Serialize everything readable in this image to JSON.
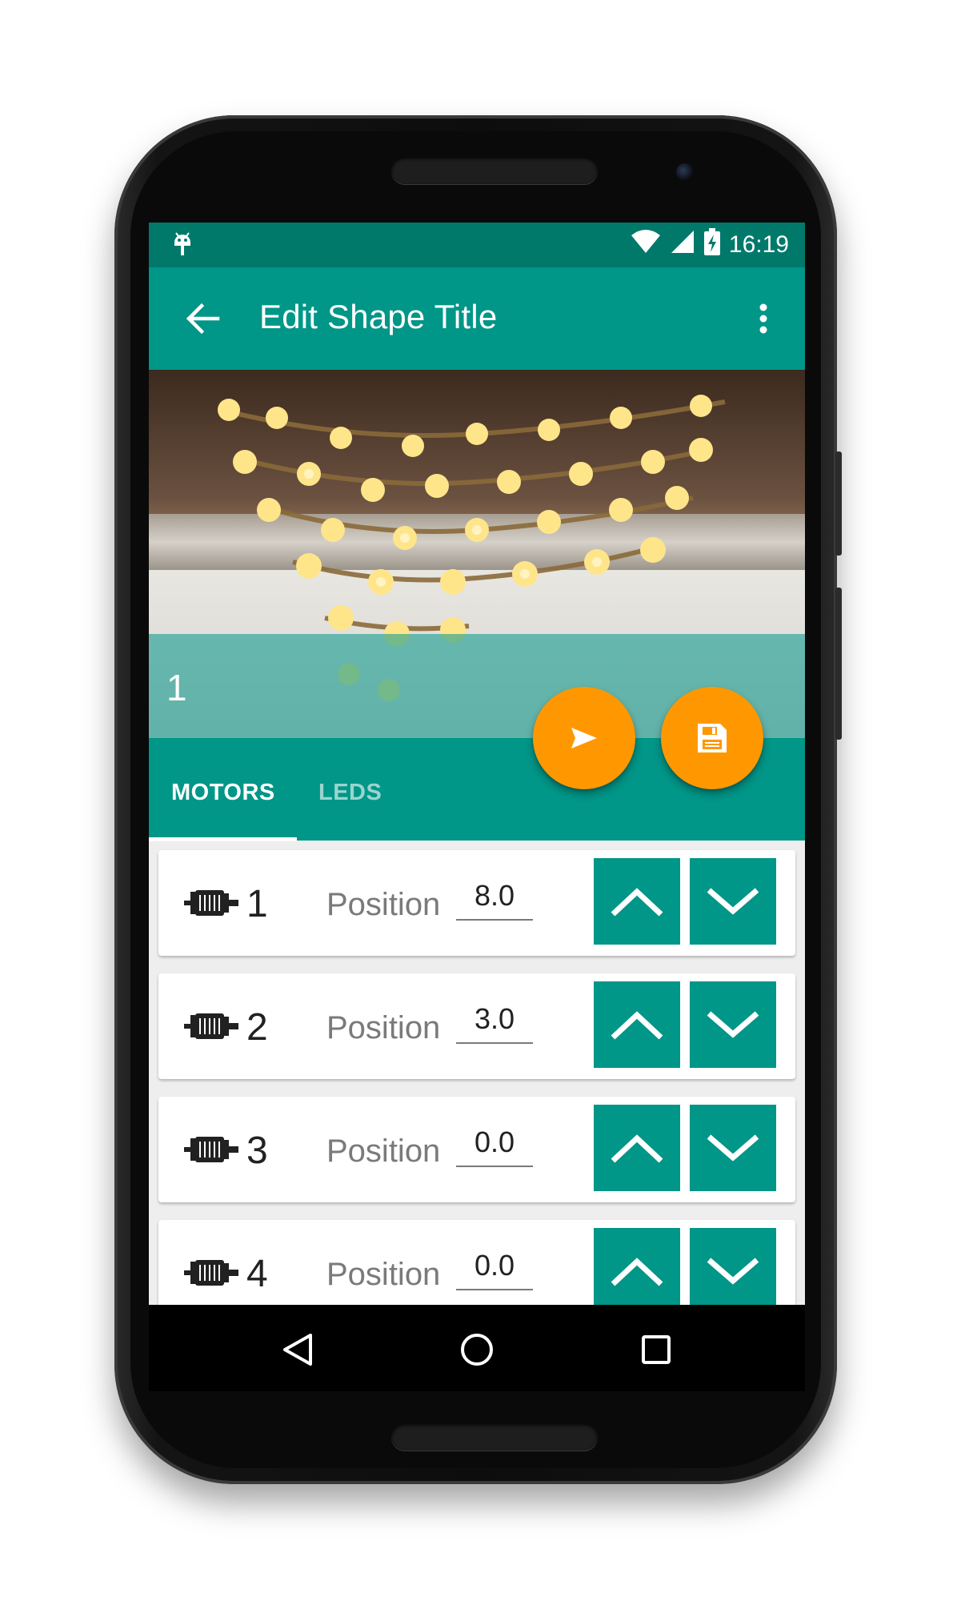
{
  "status_bar": {
    "time": "16:19",
    "icons": [
      "android-debug-icon",
      "wifi-icon",
      "signal-icon",
      "battery-charging-icon"
    ]
  },
  "toolbar": {
    "title": "Edit Shape Title",
    "back_icon": "arrow-back-icon",
    "menu_icon": "more-vert-icon"
  },
  "hero": {
    "label": "1"
  },
  "fabs": {
    "send_icon": "send-icon",
    "save_icon": "save-icon"
  },
  "tabs": [
    {
      "label": "MOTORS",
      "active": true
    },
    {
      "label": "LEDS",
      "active": false
    }
  ],
  "motors": [
    {
      "number": "1",
      "position_label": "Position",
      "position_value": "8.0"
    },
    {
      "number": "2",
      "position_label": "Position",
      "position_value": "3.0"
    },
    {
      "number": "3",
      "position_label": "Position",
      "position_value": "0.0"
    },
    {
      "number": "4",
      "position_label": "Position",
      "position_value": "0.0"
    }
  ],
  "colors": {
    "primary": "#009688",
    "primary_dark": "#00796b",
    "accent": "#ff9800"
  }
}
